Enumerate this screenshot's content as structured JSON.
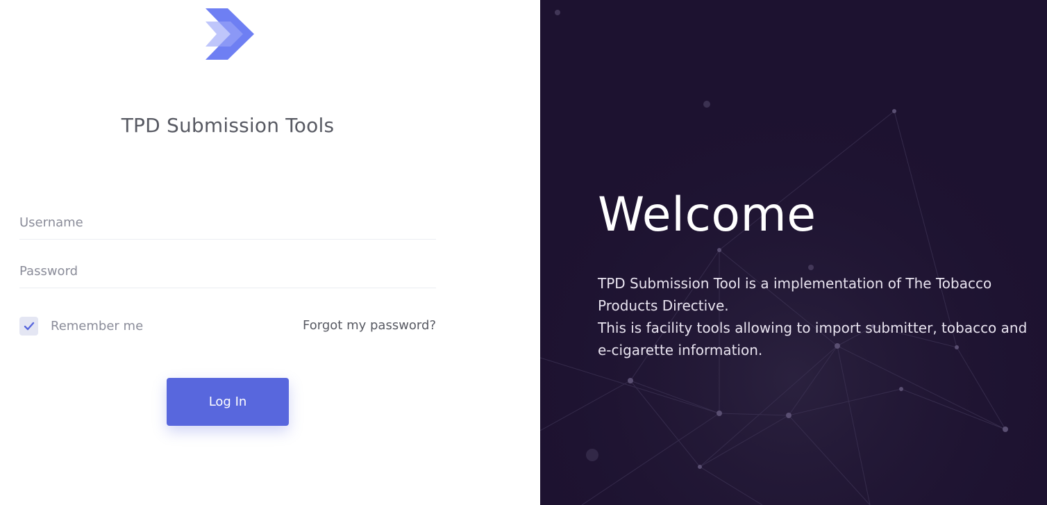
{
  "app": {
    "title": "TPD Submission Tools"
  },
  "login": {
    "username_placeholder": "Username",
    "password_placeholder": "Password",
    "remember_label": "Remember me",
    "remember_checked": true,
    "forgot_label": "Forgot my password?",
    "submit_label": "Log In"
  },
  "welcome": {
    "heading": "Welcome",
    "line1": "TPD Submission Tool is a implementation of The Tobacco Products Directive.",
    "line2": "This is facility tools allowing to import submitter, tobacco and e-cigarette information."
  },
  "colors": {
    "accent": "#5867dd",
    "dark_panel": "#1d1230",
    "logo_primary": "#6e7ff3",
    "logo_light": "#a9b2f9"
  },
  "icons": {
    "logo": "chevron-logo-icon",
    "check": "check-icon"
  }
}
